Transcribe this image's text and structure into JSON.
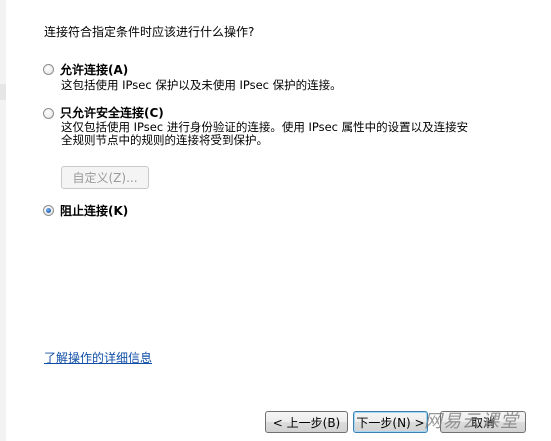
{
  "dialog": {
    "question": "连接符合指定条件时应该进行什么操作?"
  },
  "options": [
    {
      "label": "允许连接(A)",
      "description_lines": [
        "这包括使用 IPsec 保护以及未使用 IPsec 保护的连接。"
      ],
      "selected": false
    },
    {
      "label": "只允许安全连接(C)",
      "description_lines": [
        "这仅包括使用 IPsec 进行身份验证的连接。使用 IPsec 属性中的设置以及连接安",
        "全规则节点中的规则的连接将受到保护。"
      ],
      "selected": false
    },
    {
      "label": "阻止连接(K)",
      "description_lines": [],
      "selected": true
    }
  ],
  "customize_button": {
    "label": "自定义(Z)...",
    "enabled": false
  },
  "help_link": "了解操作的详细信息",
  "footer": {
    "back_label": "< 上一步(B)",
    "next_label": "下一步(N) >",
    "cancel_label": "取消"
  },
  "watermark": "网易云课堂",
  "colors": {
    "link": "#0f4ea6",
    "radio_selected": "#1f5fb4",
    "disabled_text": "#9a9a9a"
  }
}
